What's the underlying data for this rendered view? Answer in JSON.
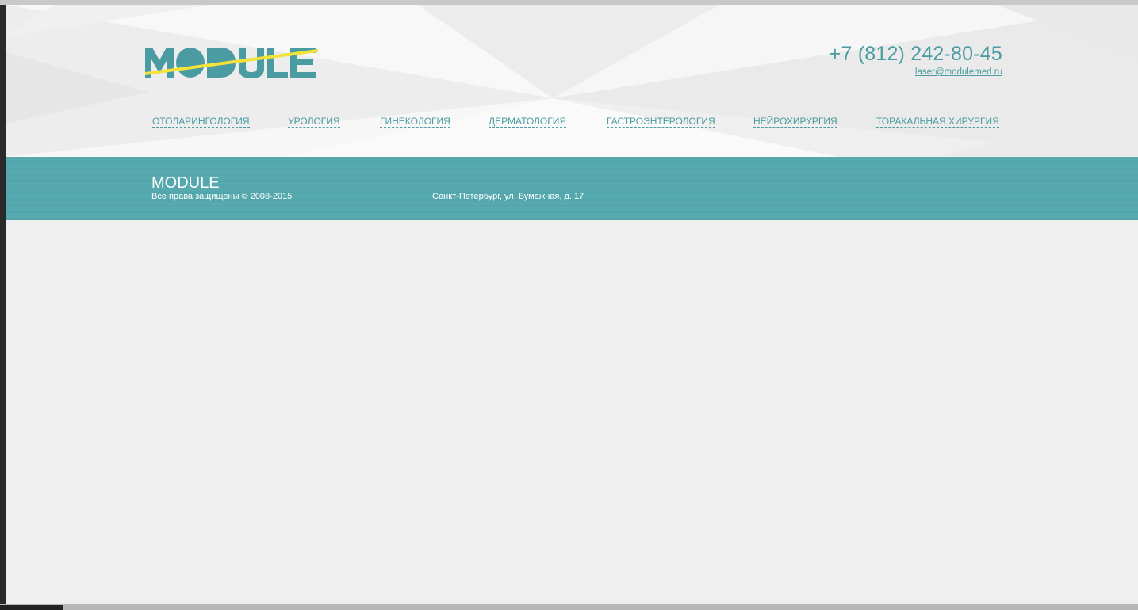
{
  "header": {
    "logo_text": "MODULE",
    "phone": "+7 (812) 242-80-45",
    "email": "laser@modulemed.ru"
  },
  "nav": {
    "items": [
      {
        "label": "ОТОЛАРИНГОЛОГИЯ"
      },
      {
        "label": "УРОЛОГИЯ"
      },
      {
        "label": "ГИНЕКОЛОГИЯ"
      },
      {
        "label": "ДЕРМАТОЛОГИЯ"
      },
      {
        "label": "ГАСТРОЭНТЕРОЛОГИЯ"
      },
      {
        "label": "НЕЙРОХИРУРГИЯ"
      },
      {
        "label": "ТОРАКАЛЬНАЯ ХИРУРГИЯ"
      }
    ]
  },
  "footer": {
    "brand": "MODULE",
    "copyright": "Все права защищены © 2008-2015",
    "address": "Санкт-Петербург, ул. Бумажная, д. 17"
  },
  "colors": {
    "accent": "#4a9ca2",
    "footer_bg": "#52a7ad",
    "logo_yellow": "#f2e23a",
    "page_bg": "#efefef"
  }
}
